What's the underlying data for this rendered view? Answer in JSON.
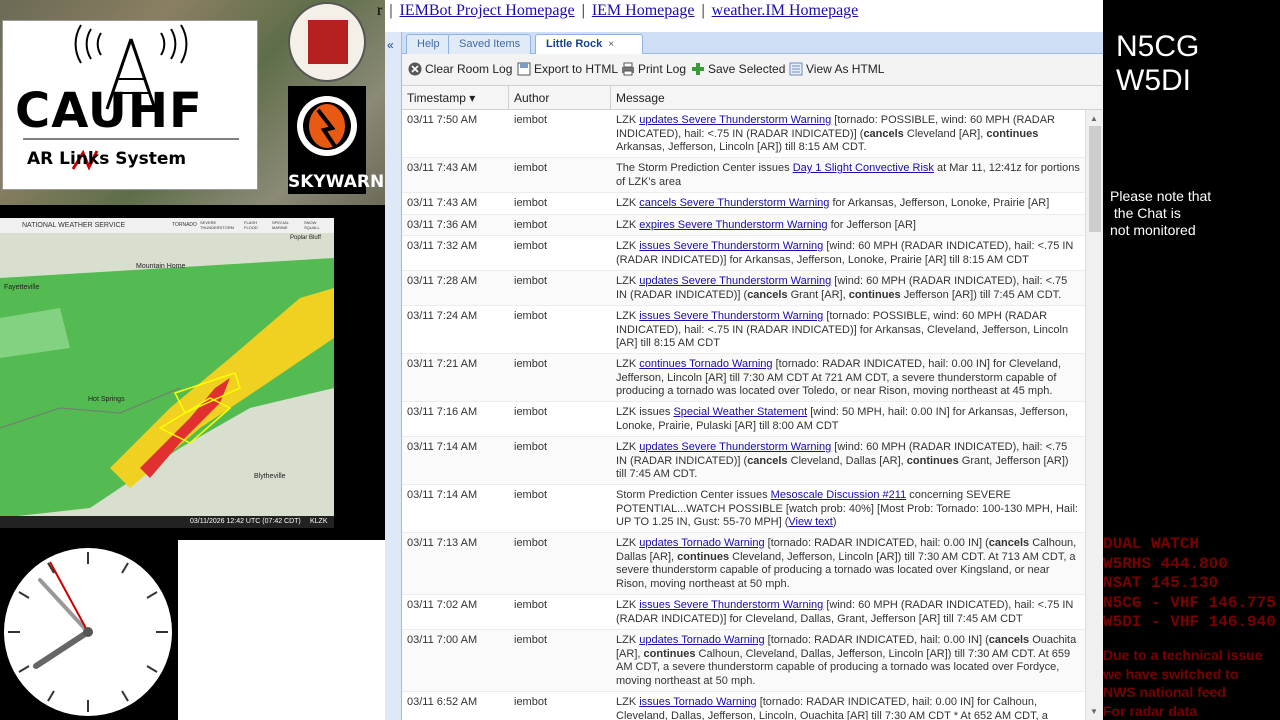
{
  "logos": {
    "cauhf_main": "CAUHF",
    "cauhf_sub": "AR Links System",
    "skywarn": "SKYWARN"
  },
  "radar": {
    "source": "NATIONAL WEATHER SERVICE",
    "legend": [
      "TORNADO",
      "SEVERE THUNDERSTORM",
      "FLASH FLOOD",
      "SPECIAL MARINE",
      "SNOW SQUALL"
    ],
    "places": [
      "Mountain Home",
      "Fayetteville",
      "Hot Springs",
      "Blytheville",
      "Poplar Bluff"
    ],
    "timestamp": "03/11/2026 12:42 UTC (07:42 CDT)",
    "station": "KLZK"
  },
  "toplinks": {
    "prefix": "r",
    "links": [
      "IEMBot Project Homepage",
      "IEM Homepage",
      "weather.IM Homepage"
    ],
    "separator": "|"
  },
  "collapse_symbol": "«",
  "tabs": [
    {
      "label": "Help"
    },
    {
      "label": "Saved Items"
    },
    {
      "label": "Little Rock",
      "close": "×"
    }
  ],
  "toolbar": {
    "clear": "Clear Room Log",
    "export": "Export to HTML",
    "print": "Print Log",
    "save": "Save Selected",
    "view": "View As HTML"
  },
  "grid": {
    "headers": {
      "timestamp": "Timestamp ▾",
      "author": "Author",
      "message": "Message"
    },
    "rows": [
      {
        "ts": "03/11 7:50 AM",
        "author": "iembot",
        "h": 48
      },
      {
        "ts": "03/11 7:43 AM",
        "author": "iembot",
        "h": 35
      },
      {
        "ts": "03/11 7:43 AM",
        "author": "iembot",
        "h": 22
      },
      {
        "ts": "03/11 7:36 AM",
        "author": "iembot",
        "h": 21
      },
      {
        "ts": "03/11 7:32 AM",
        "author": "iembot",
        "h": 35
      },
      {
        "ts": "03/11 7:28 AM",
        "author": "iembot",
        "h": 35
      },
      {
        "ts": "03/11 7:24 AM",
        "author": "iembot",
        "h": 48
      },
      {
        "ts": "03/11 7:21 AM",
        "author": "iembot",
        "h": 48
      },
      {
        "ts": "03/11 7:16 AM",
        "author": "iembot",
        "h": 35
      },
      {
        "ts": "03/11 7:14 AM",
        "author": "iembot",
        "h": 48
      },
      {
        "ts": "03/11 7:14 AM",
        "author": "iembot",
        "h": 48
      },
      {
        "ts": "03/11 7:13 AM",
        "author": "iembot",
        "h": 62
      },
      {
        "ts": "03/11 7:02 AM",
        "author": "iembot",
        "h": 35
      },
      {
        "ts": "03/11 7:00 AM",
        "author": "iembot",
        "h": 62
      },
      {
        "ts": "03/11 6:52 AM",
        "author": "iembot",
        "h": 35
      }
    ],
    "messages": [
      [
        {
          "t": "LZK "
        },
        {
          "a": "updates Severe Thunderstorm Warning"
        },
        {
          "t": " [tornado: POSSIBLE, wind: 60 MPH (RADAR INDICATED), hail: <.75 IN (RADAR INDICATED)] ("
        },
        {
          "b": "cancels"
        },
        {
          "t": " Cleveland [AR], "
        },
        {
          "b": "continues"
        },
        {
          "t": " Arkansas, Jefferson, Lincoln [AR]) till 8:15 AM CDT."
        }
      ],
      [
        {
          "t": "The Storm Prediction Center issues "
        },
        {
          "a": "Day 1 Slight Convective Risk"
        },
        {
          "t": " at Mar 11, 12:41z for portions of LZK's area"
        }
      ],
      [
        {
          "t": "LZK "
        },
        {
          "a": "cancels Severe Thunderstorm Warning"
        },
        {
          "t": " for Arkansas, Jefferson, Lonoke, Prairie [AR]"
        }
      ],
      [
        {
          "t": "LZK "
        },
        {
          "a": "expires Severe Thunderstorm Warning"
        },
        {
          "t": " for Jefferson [AR]"
        }
      ],
      [
        {
          "t": "LZK "
        },
        {
          "a": "issues Severe Thunderstorm Warning"
        },
        {
          "t": " [wind: 60 MPH (RADAR INDICATED), hail: <.75 IN (RADAR INDICATED)] for Arkansas, Jefferson, Lonoke, Prairie [AR] till 8:15 AM CDT"
        }
      ],
      [
        {
          "t": "LZK "
        },
        {
          "a": "updates Severe Thunderstorm Warning"
        },
        {
          "t": " [wind: 60 MPH (RADAR INDICATED), hail: <.75 IN (RADAR INDICATED)] ("
        },
        {
          "b": "cancels"
        },
        {
          "t": " Grant [AR], "
        },
        {
          "b": "continues"
        },
        {
          "t": " Jefferson [AR]) till 7:45 AM CDT."
        }
      ],
      [
        {
          "t": "LZK "
        },
        {
          "a": "issues Severe Thunderstorm Warning"
        },
        {
          "t": " [tornado: POSSIBLE, wind: 60 MPH (RADAR INDICATED), hail: <.75 IN (RADAR INDICATED)] for Arkansas, Cleveland, Jefferson, Lincoln [AR] till 8:15 AM CDT"
        }
      ],
      [
        {
          "t": "LZK "
        },
        {
          "a": "continues Tornado Warning"
        },
        {
          "t": " [tornado: RADAR INDICATED, hail: 0.00 IN] for Cleveland, Jefferson, Lincoln [AR] till 7:30 AM CDT At 721 AM CDT, a severe thunderstorm capable of producing a tornado was located over Toledo, or near Rison, moving northeast at 45 mph."
        }
      ],
      [
        {
          "t": "LZK issues "
        },
        {
          "a": "Special Weather Statement"
        },
        {
          "t": " [wind: 50 MPH, hail: 0.00 IN] for Arkansas, Jefferson, Lonoke, Prairie, Pulaski [AR] till 8:00 AM CDT"
        }
      ],
      [
        {
          "t": "LZK "
        },
        {
          "a": "updates Severe Thunderstorm Warning"
        },
        {
          "t": " [wind: 60 MPH (RADAR INDICATED), hail: <.75 IN (RADAR INDICATED)] ("
        },
        {
          "b": "cancels"
        },
        {
          "t": " Cleveland, Dallas [AR], "
        },
        {
          "b": "continues"
        },
        {
          "t": " Grant, Jefferson [AR]) till 7:45 AM CDT."
        }
      ],
      [
        {
          "t": "Storm Prediction Center issues "
        },
        {
          "a": "Mesoscale Discussion #211"
        },
        {
          "t": " concerning SEVERE POTENTIAL...WATCH POSSIBLE [watch prob: 40%] [Most Prob: Tornado: 100-130 MPH, Hail: UP TO 1.25 IN, Gust: 55-70 MPH] ("
        },
        {
          "a": "View text"
        },
        {
          "t": ")"
        }
      ],
      [
        {
          "t": "LZK "
        },
        {
          "a": "updates Tornado Warning"
        },
        {
          "t": " [tornado: RADAR INDICATED, hail: 0.00 IN] ("
        },
        {
          "b": "cancels"
        },
        {
          "t": " Calhoun, Dallas [AR], "
        },
        {
          "b": "continues"
        },
        {
          "t": " Cleveland, Jefferson, Lincoln [AR]) till 7:30 AM CDT. At 713 AM CDT, a severe thunderstorm capable of producing a tornado was located over Kingsland, or near Rison, moving northeast at 50 mph."
        }
      ],
      [
        {
          "t": "LZK "
        },
        {
          "a": "issues Severe Thunderstorm Warning"
        },
        {
          "t": " [wind: 60 MPH (RADAR INDICATED), hail: <.75 IN (RADAR INDICATED)] for Cleveland, Dallas, Grant, Jefferson [AR] till 7:45 AM CDT"
        }
      ],
      [
        {
          "t": "LZK "
        },
        {
          "a": "updates Tornado Warning"
        },
        {
          "t": " [tornado: RADAR INDICATED, hail: 0.00 IN] ("
        },
        {
          "b": "cancels"
        },
        {
          "t": " Ouachita [AR], "
        },
        {
          "b": "continues"
        },
        {
          "t": " Calhoun, Cleveland, Dallas, Jefferson, Lincoln [AR]) till 7:30 AM CDT. At 659 AM CDT, a severe thunderstorm capable of producing a tornado was located over Fordyce, moving northeast at 50 mph."
        }
      ],
      [
        {
          "t": "LZK "
        },
        {
          "a": "issues Tornado Warning"
        },
        {
          "t": " [tornado: RADAR INDICATED, hail: 0.00 IN] for Calhoun, Cleveland, Dallas, Jefferson, Lincoln, Ouachita [AR] till 7:30 AM CDT * At 652 AM CDT, a"
        }
      ]
    ]
  },
  "right": {
    "call1": "N5CG",
    "call2": "W5DI",
    "note_lines": [
      "Please note that",
      " the Chat is",
      "not monitored"
    ],
    "dual_lines": [
      "DUAL WATCH",
      "W5RHS 444.800",
      "NSAT 145.130",
      "N5CG - VHF 146.775",
      "W5DI - VHF 146.940"
    ],
    "tech_lines": [
      "Due to a technical issue",
      "we have switched to",
      "NWS national feed",
      "For radar data"
    ]
  },
  "colors": {
    "accent_link": "#1a0dab",
    "ext_tab_bg": "#cedff5",
    "alert_red": "#7a0000"
  }
}
